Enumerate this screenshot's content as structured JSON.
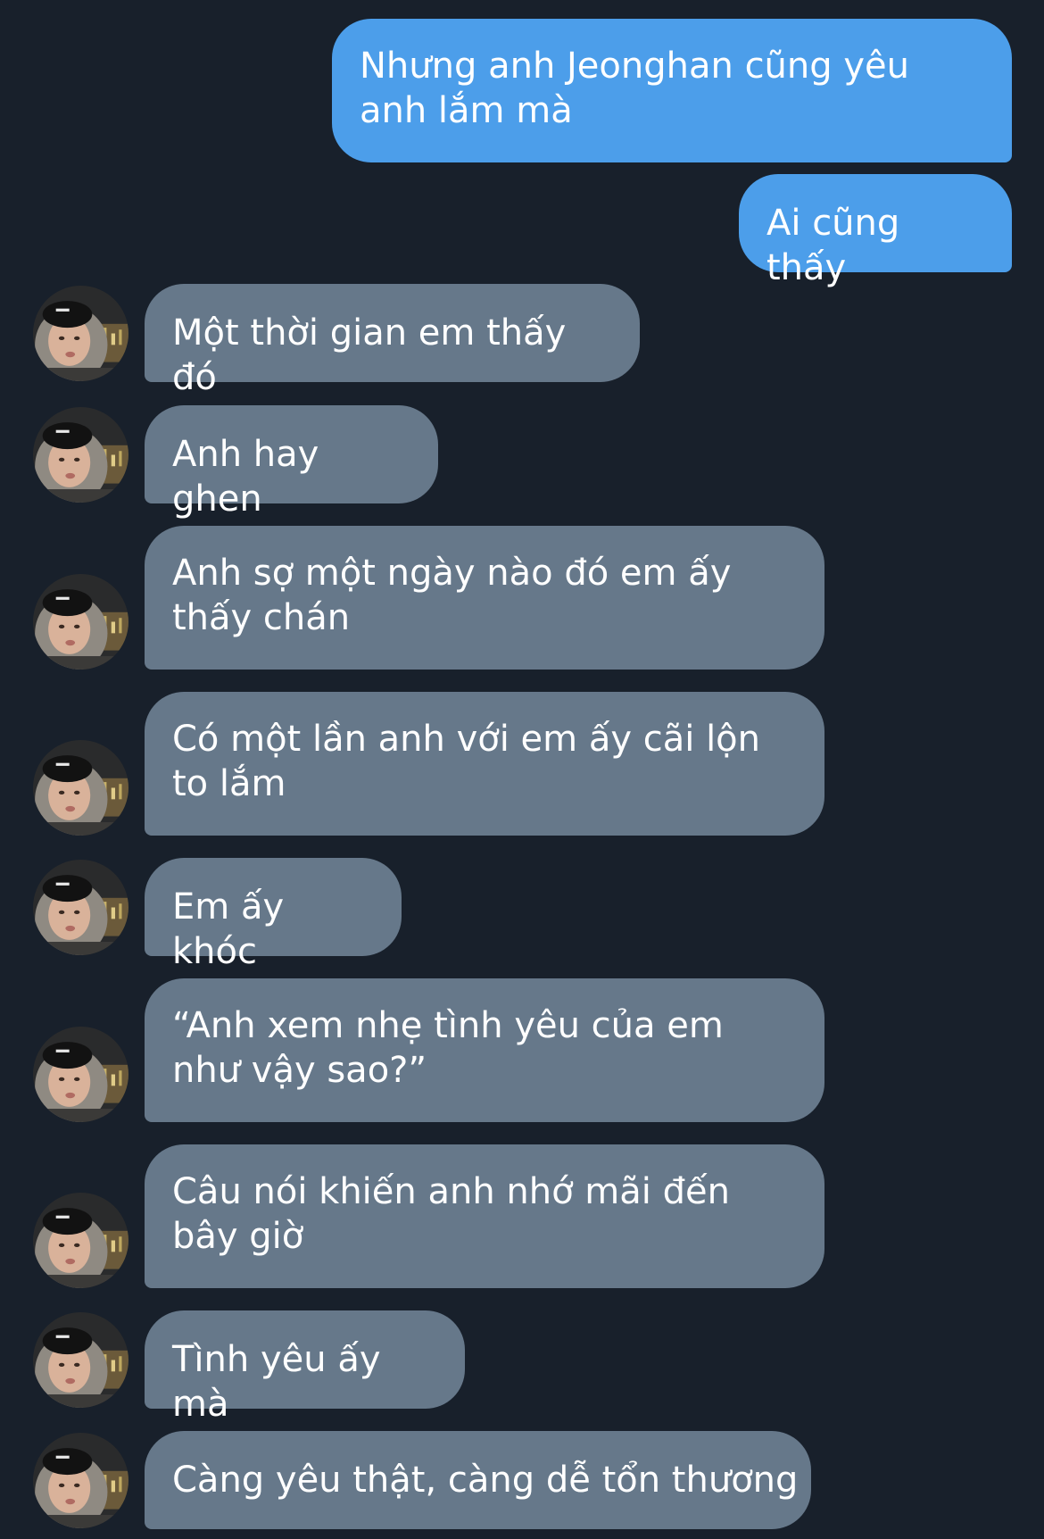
{
  "thread": {
    "outgoing": [
      {
        "text": "Nhưng anh Jeonghan cũng yêu anh lắm mà"
      },
      {
        "text": "Ai cũng thấy"
      }
    ],
    "incoming": [
      {
        "text": "Một thời gian em thấy đó"
      },
      {
        "text": "Anh hay ghen"
      },
      {
        "text": "Anh sợ một ngày nào đó em ấy thấy chán"
      },
      {
        "text": "Có một lần anh với em ấy cãi lộn to lắm"
      },
      {
        "text": "Em ấy khóc"
      },
      {
        "text": "“Anh xem nhẹ tình yêu của em như vậy sao?”"
      },
      {
        "text": "Câu nói khiến anh nhớ mãi đến bây giờ"
      },
      {
        "text": "Tình yêu ấy mà"
      },
      {
        "text": "Càng yêu thật, càng dễ tổn thương"
      }
    ]
  },
  "avatar": {
    "icon": "contact-avatar-photo"
  },
  "colors": {
    "background": "#18202b",
    "outgoing_bubble": "#4c9eea",
    "incoming_bubble": "#66788a",
    "text": "#ffffff"
  }
}
